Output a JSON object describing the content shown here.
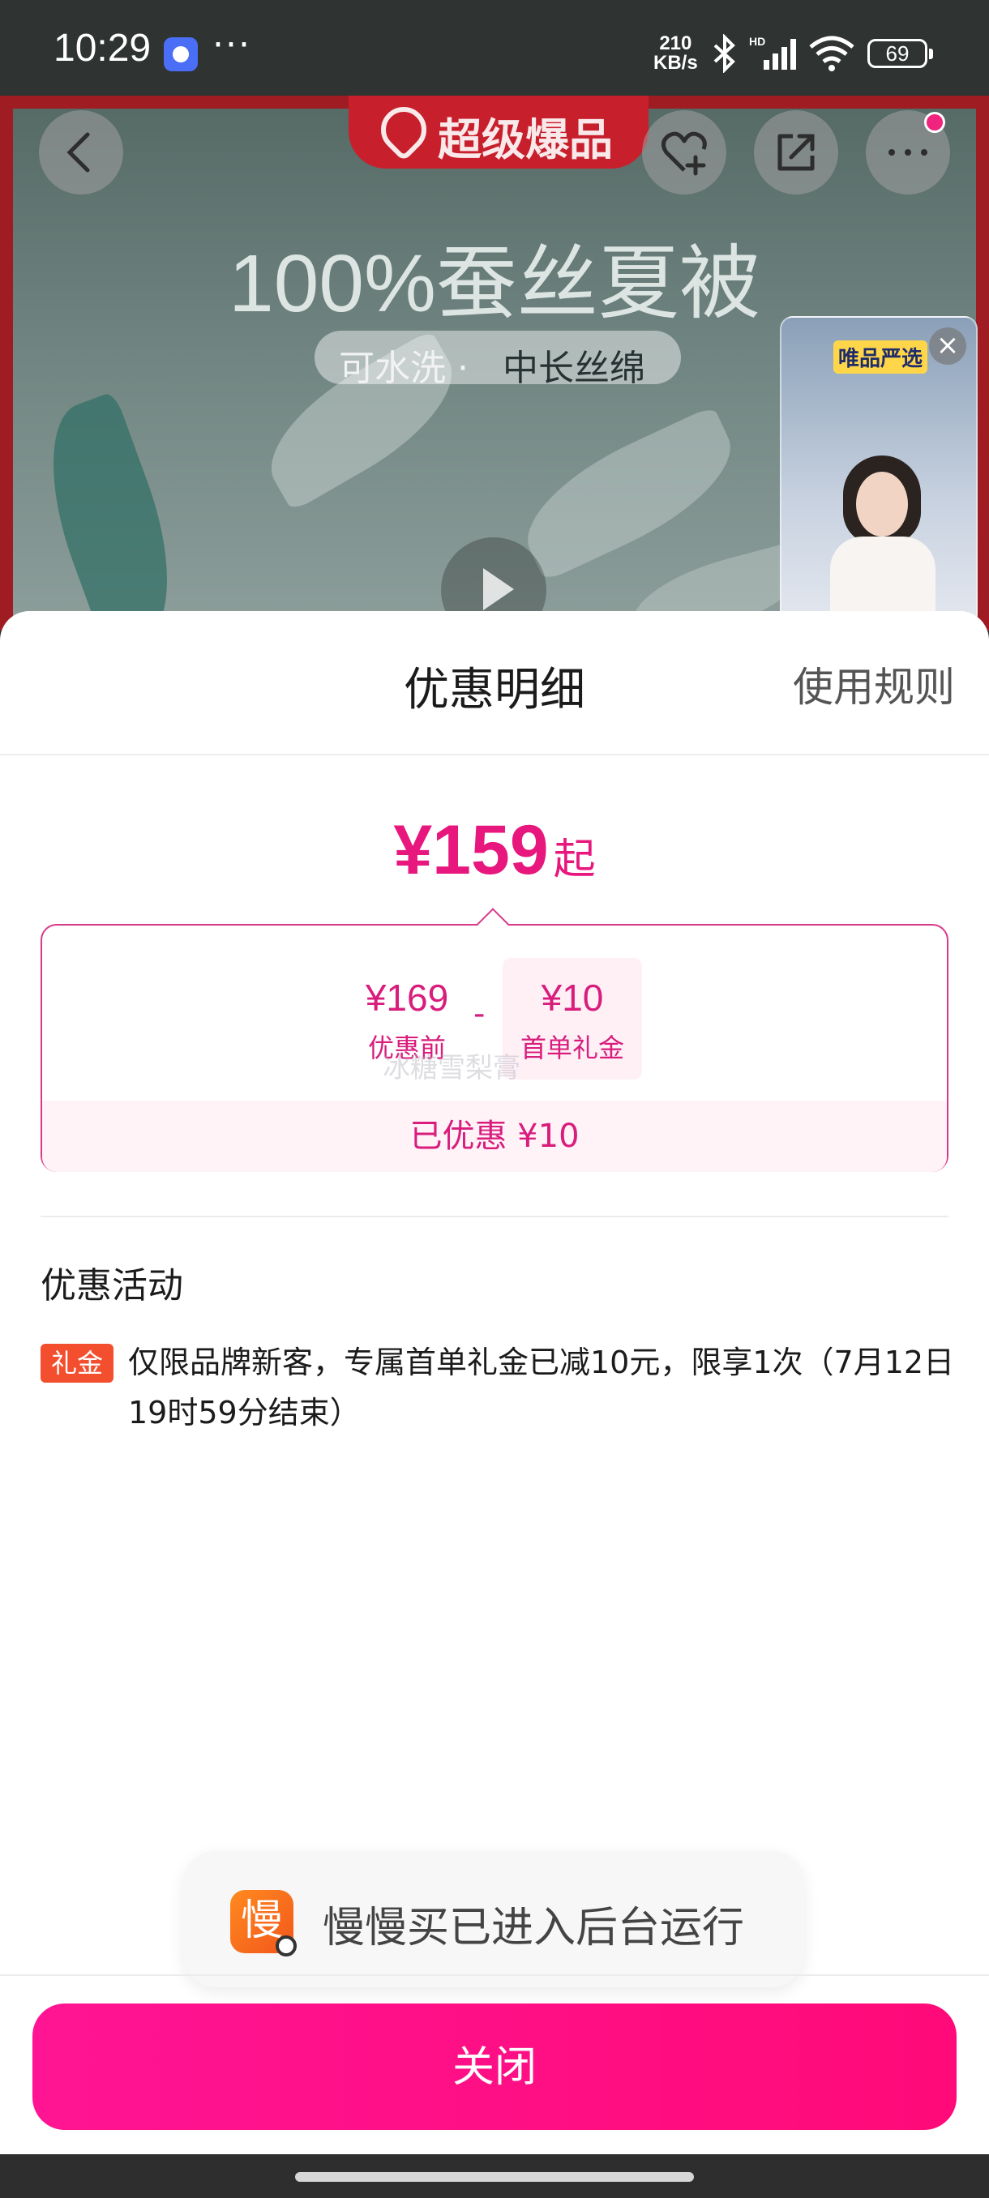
{
  "status_bar": {
    "time": "10:29",
    "more": "···",
    "net_speed_value": "210",
    "net_speed_unit": "KB/s",
    "battery": "69"
  },
  "product_banner": {
    "brand_tag": "超级爆品",
    "headline": "100%蚕丝夏被",
    "sub_left": "可水洗 ·",
    "sub_right": "中长丝绵",
    "floating_video_badge": "唯品严选",
    "floating_video_close": "×"
  },
  "sheet": {
    "title": "优惠明细",
    "rules_link": "使用规则",
    "final_price": "¥159",
    "final_price_suffix": "起",
    "calc": {
      "original_value": "¥169",
      "original_label": "优惠前",
      "operator": "-",
      "discount_value": "¥10",
      "discount_label": "首单礼金",
      "watermark": "冰糖雪梨膏",
      "saved_text": "已优惠 ¥10"
    },
    "promotions_title": "优惠活动",
    "promotion": {
      "tag": "礼金",
      "text": "仅限品牌新客，专属首单礼金已减10元，限享1次（7月12日19时59分结束）"
    }
  },
  "toast": {
    "app_icon_char": "慢",
    "text": "慢慢买已进入后台运行"
  },
  "close_button": "关闭",
  "colors": {
    "accent": "#e8177d",
    "button": "#ff0a78",
    "gift_tag": "#f34e2e"
  }
}
